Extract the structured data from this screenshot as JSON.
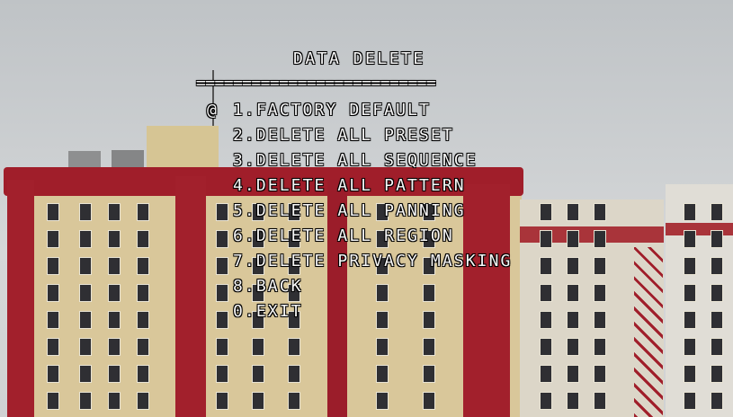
{
  "osd": {
    "title": "DATA DELETE",
    "rule": "==========================",
    "cursor": "@",
    "selected_index": 0,
    "items": [
      "1.FACTORY DEFAULT",
      "2.DELETE ALL PRESET",
      "3.DELETE ALL SEQUENCE",
      "4.DELETE ALL PATTERN",
      "5.DELETE ALL PANNING",
      "6.DELETE ALL REGION",
      "7.DELETE PRIVACY MASKING",
      "8.BACK",
      "0.EXIT"
    ]
  },
  "colors": {
    "osd_text": "#f7f7f7",
    "sky": "#cdd0d2",
    "building_facade": "#d9c79a",
    "building_trim": "#a01e2a"
  }
}
